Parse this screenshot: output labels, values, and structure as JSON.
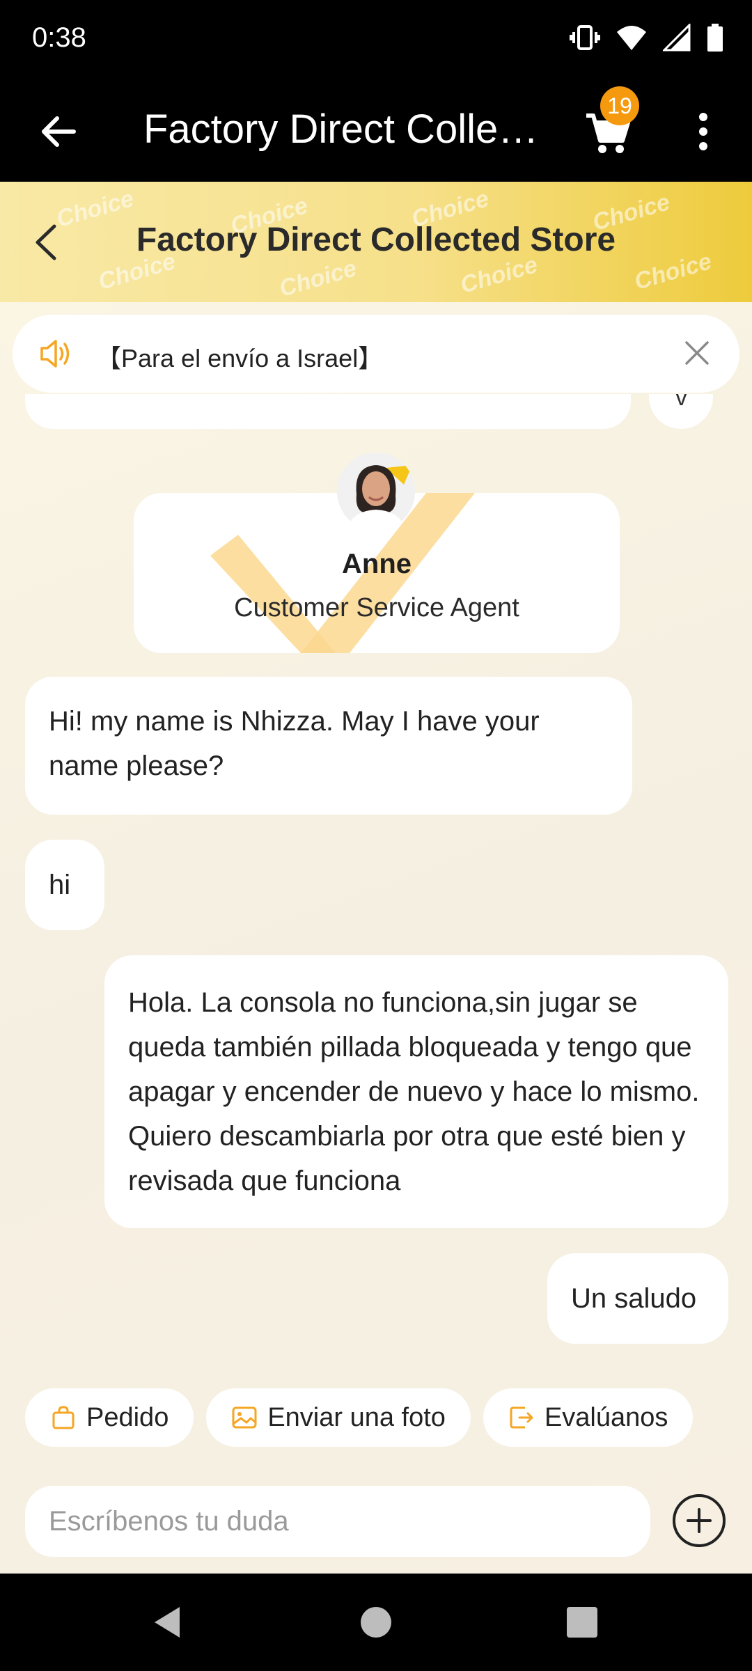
{
  "status_bar": {
    "time": "0:38"
  },
  "app_bar": {
    "title": "Factory Direct Collec…",
    "cart_count": "19"
  },
  "store_header": {
    "title": "Factory Direct Collected Store",
    "watermark": "Choice"
  },
  "notice": {
    "text": "【Para el envío a Israel】"
  },
  "agent": {
    "name": "Anne",
    "role": "Customer Service Agent"
  },
  "messages": [
    {
      "side": "left",
      "text": "Hi! my name is Nhizza. May I have your name please?"
    },
    {
      "side": "left",
      "text": "hi"
    },
    {
      "side": "right",
      "text": "Hola. La consola no funciona,sin jugar se queda también pillada bloqueada y tengo que apagar y encender de nuevo y hace lo mismo. Quiero descambiarla por otra que esté bien y revisada que funciona"
    },
    {
      "side": "right",
      "text": "Un saludo"
    }
  ],
  "quick_actions": [
    {
      "label": "Pedido",
      "icon": "bag-icon"
    },
    {
      "label": "Enviar una foto",
      "icon": "image-icon"
    },
    {
      "label": "Evalúanos",
      "icon": "rate-icon"
    }
  ],
  "input": {
    "placeholder": "Escríbenos tu duda",
    "value": ""
  },
  "colors": {
    "accent": "#f5a623",
    "badge": "#f59a0f",
    "header_gold": "#eecb3c"
  }
}
